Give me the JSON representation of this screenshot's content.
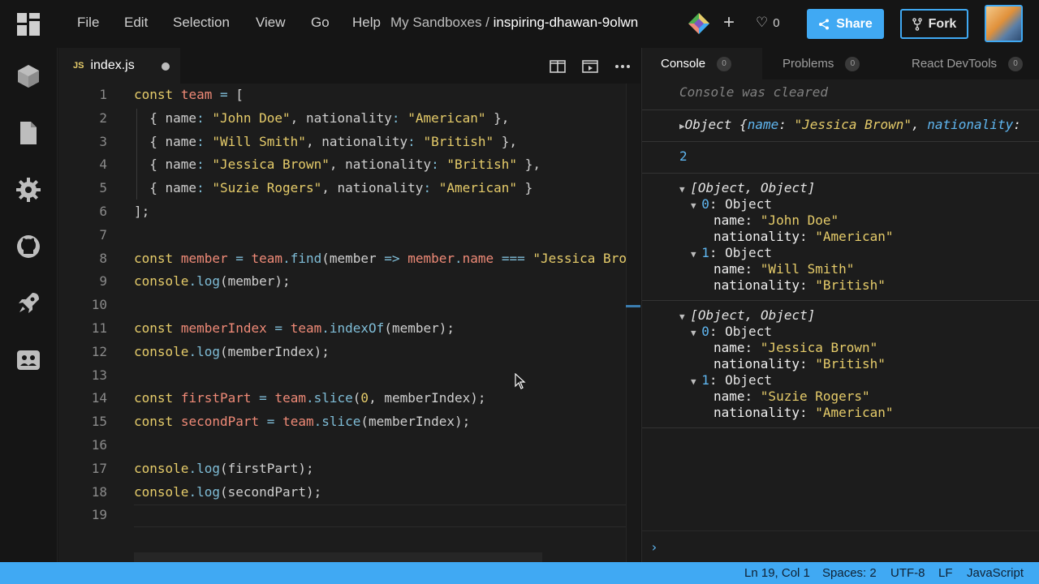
{
  "menu": [
    "File",
    "Edit",
    "Selection",
    "View",
    "Go",
    "Help"
  ],
  "breadcrumb": {
    "prefix": "My Sandboxes / ",
    "name": "inspiring-dhawan-9olwn"
  },
  "toolbar": {
    "plus": "+",
    "likes": "0",
    "share_label": "Share",
    "fork_label": "Fork"
  },
  "activity": [
    "sandbox-icon",
    "file-icon",
    "gear-icon",
    "github-icon",
    "rocket-icon",
    "team-icon"
  ],
  "editor": {
    "tab": {
      "badge": "JS",
      "filename": "index.js"
    },
    "lines": [
      {
        "n": "1",
        "html": "<span class='kw'>const</span> <span class='var'>team</span> <span class='op'>=</span> ["
      },
      {
        "n": "2",
        "html": "  { name<span class='op'>:</span> <span class='str'>\"John Doe\"</span>, nationality<span class='op'>:</span> <span class='str'>\"American\"</span> },"
      },
      {
        "n": "3",
        "html": "  { name<span class='op'>:</span> <span class='str'>\"Will Smith\"</span>, nationality<span class='op'>:</span> <span class='str'>\"British\"</span> },"
      },
      {
        "n": "4",
        "html": "  { name<span class='op'>:</span> <span class='str'>\"Jessica Brown\"</span>, nationality<span class='op'>:</span> <span class='str'>\"British\"</span> },"
      },
      {
        "n": "5",
        "html": "  { name<span class='op'>:</span> <span class='str'>\"Suzie Rogers\"</span>, nationality<span class='op'>:</span> <span class='str'>\"American\"</span> }"
      },
      {
        "n": "6",
        "html": "];"
      },
      {
        "n": "7",
        "html": ""
      },
      {
        "n": "8",
        "html": "<span class='kw'>const</span> <span class='var'>member</span> <span class='op'>=</span> <span class='var'>team</span><span class='op'>.</span><span class='fn'>find</span>(member <span class='op'>=&gt;</span> <span class='var'>member</span><span class='op'>.</span><span class='var'>name</span> <span class='op'>===</span> <span class='str'>\"Jessica Brown\"</span>);"
      },
      {
        "n": "9",
        "html": "<span class='kw'>console</span><span class='op'>.</span><span class='fn'>log</span>(member);"
      },
      {
        "n": "10",
        "html": ""
      },
      {
        "n": "11",
        "html": "<span class='kw'>const</span> <span class='var'>memberIndex</span> <span class='op'>=</span> <span class='var'>team</span><span class='op'>.</span><span class='fn'>indexOf</span>(member);"
      },
      {
        "n": "12",
        "html": "<span class='kw'>console</span><span class='op'>.</span><span class='fn'>log</span>(memberIndex);"
      },
      {
        "n": "13",
        "html": ""
      },
      {
        "n": "14",
        "html": "<span class='kw'>const</span> <span class='var'>firstPart</span> <span class='op'>=</span> <span class='var'>team</span><span class='op'>.</span><span class='fn'>slice</span>(<span class='num'>0</span>, memberIndex);"
      },
      {
        "n": "15",
        "html": "<span class='kw'>const</span> <span class='var'>secondPart</span> <span class='op'>=</span> <span class='var'>team</span><span class='op'>.</span><span class='fn'>slice</span>(memberIndex);"
      },
      {
        "n": "16",
        "html": ""
      },
      {
        "n": "17",
        "html": "<span class='kw'>console</span><span class='op'>.</span><span class='fn'>log</span>(firstPart);"
      },
      {
        "n": "18",
        "html": "<span class='kw'>console</span><span class='op'>.</span><span class='fn'>log</span>(secondPart);"
      },
      {
        "n": "19",
        "html": ""
      }
    ]
  },
  "panel": {
    "tabs": [
      {
        "label": "Console",
        "count": "0"
      },
      {
        "label": "Problems",
        "count": "0"
      },
      {
        "label": "React DevTools",
        "count": "0"
      }
    ],
    "console": {
      "cleared": "Console was cleared",
      "object_prefix": "Object {",
      "object_key1": "name",
      "object_val1": "\"Jessica Brown\"",
      "object_key2": "nationality",
      "index_value": "2",
      "array_label": "[Object, Object]",
      "item0": "0",
      "item1": "1",
      "obj_label": "Object",
      "name_key": "name",
      "nat_key": "nationality",
      "first": [
        {
          "name": "\"John Doe\"",
          "nationality": "\"American\""
        },
        {
          "name": "\"Will Smith\"",
          "nationality": "\"British\""
        }
      ],
      "second": [
        {
          "name": "\"Jessica Brown\"",
          "nationality": "\"British\""
        },
        {
          "name": "\"Suzie Rogers\"",
          "nationality": "\"American\""
        }
      ],
      "prompt": "›"
    }
  },
  "status": {
    "position": "Ln 19, Col 1",
    "spaces": "Spaces: 2",
    "encoding": "UTF-8",
    "eol": "LF",
    "language": "JavaScript"
  },
  "colors": {
    "accent": "#40a9f3",
    "background": "#151515",
    "editor": "#1c1c1c"
  }
}
